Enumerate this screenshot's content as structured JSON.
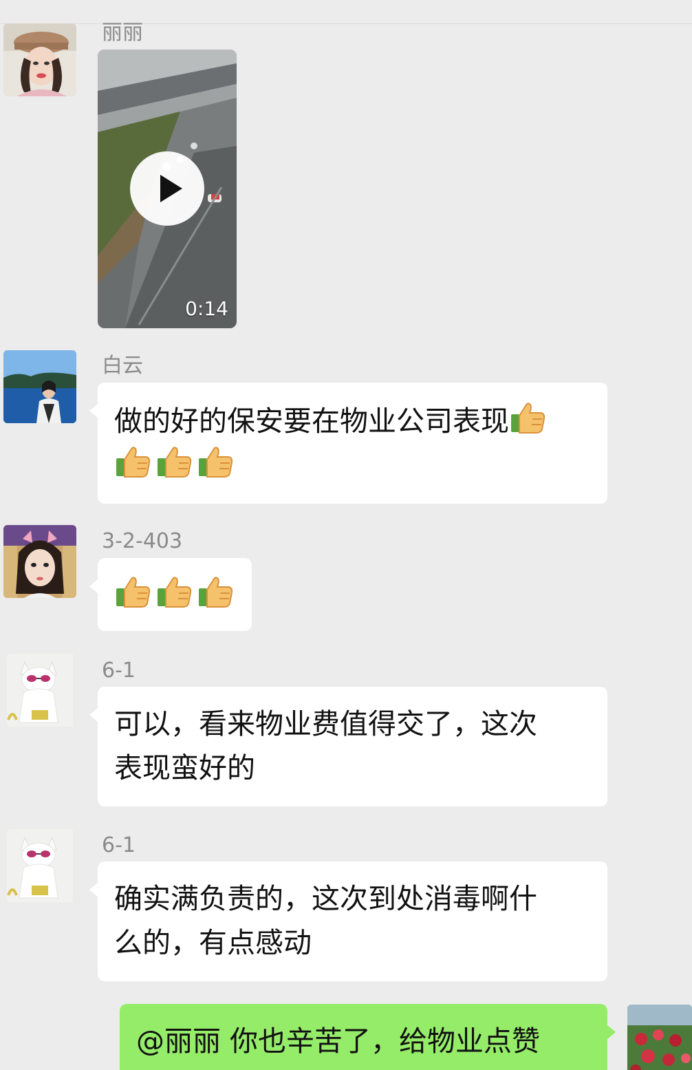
{
  "colors": {
    "background": "#ececec",
    "bubble_incoming": "#ffffff",
    "bubble_outgoing": "#95ec69",
    "sender_name": "#8a8a8a"
  },
  "messages": [
    {
      "sender": "丽丽",
      "type": "video",
      "duration": "0:14",
      "avatar_icon": "avatar-woman-hat-icon"
    },
    {
      "sender": "白云",
      "type": "text",
      "lines": [
        "做的好的保安要在物业公司表现",
        ""
      ],
      "emoji_line1": [
        "thumbs-up-icon"
      ],
      "emoji_line2": [
        "thumbs-up-icon",
        "thumbs-up-icon",
        "thumbs-up-icon"
      ],
      "avatar_icon": "avatar-lake-portrait-icon"
    },
    {
      "sender": "3-2-403",
      "type": "emoji",
      "emojis": [
        "thumbs-up-icon",
        "thumbs-up-icon",
        "thumbs-up-icon"
      ],
      "avatar_icon": "avatar-girl-cat-ears-icon"
    },
    {
      "sender": "6-1",
      "type": "text",
      "lines": [
        "可以，看来物业费值得交了，这次",
        "表现蛮好的"
      ],
      "avatar_icon": "avatar-white-cat-icon"
    },
    {
      "sender": "6-1",
      "type": "text",
      "lines": [
        "确实满负责的，这次到处消毒啊什",
        "么的，有点感动"
      ],
      "avatar_icon": "avatar-white-cat-icon"
    },
    {
      "sender": "me",
      "type": "text",
      "lines": [
        "@丽丽  你也辛苦了，给物业点赞"
      ],
      "avatar_icon": "avatar-flowers-icon"
    }
  ]
}
